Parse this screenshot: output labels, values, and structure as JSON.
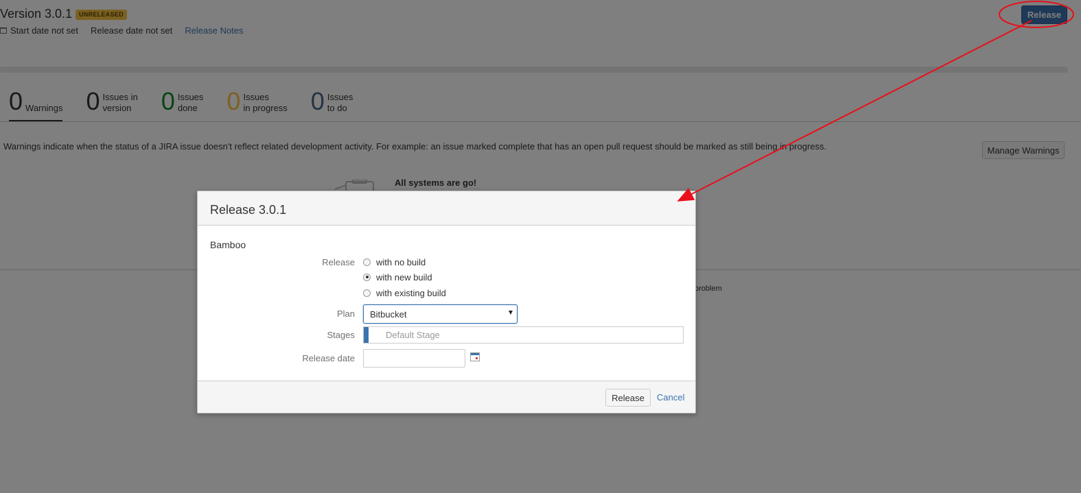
{
  "version": {
    "title": "Version 3.0.1",
    "badge": "UNRELEASED",
    "start_date": "Start date not set",
    "release_date": "Release date not set",
    "release_notes_link": "Release Notes",
    "release_button": "Release"
  },
  "stats": [
    {
      "number": "0",
      "label_line1": "Warnings",
      "label_line2": ""
    },
    {
      "number": "0",
      "label_line1": "Issues in",
      "label_line2": "version"
    },
    {
      "number": "0",
      "label_line1": "Issues",
      "label_line2": "done"
    },
    {
      "number": "0",
      "label_line1": "Issues",
      "label_line2": "in progress"
    },
    {
      "number": "0",
      "label_line1": "Issues",
      "label_line2": "to do"
    }
  ],
  "warnings": {
    "description": "Warnings indicate when the status of a JIRA issue doesn't reflect related development activity. For example: an issue marked complete that has an open pull request should be marked as still being in progress.",
    "manage_button": "Manage Warnings",
    "empty_title": "All systems are go!",
    "problem_fragment": "problem"
  },
  "dialog": {
    "title": "Release 3.0.1",
    "section": "Bamboo",
    "release_label": "Release",
    "radio_options": [
      {
        "label": "with no build",
        "checked": false
      },
      {
        "label": "with new build",
        "checked": true
      },
      {
        "label": "with existing build",
        "checked": false
      }
    ],
    "plan_label": "Plan",
    "plan_value": "Bitbucket",
    "stages_label": "Stages",
    "stage_value": "Default Stage",
    "release_date_label": "Release date",
    "release_date_value": "",
    "release_button": "Release",
    "cancel_link": "Cancel"
  },
  "colors": {
    "accent": "#3b73af",
    "badge": "#f6c342",
    "done": "#14892c",
    "in_progress": "#f6c342",
    "to_do": "#4a6785",
    "annotation": "#e8101a"
  }
}
